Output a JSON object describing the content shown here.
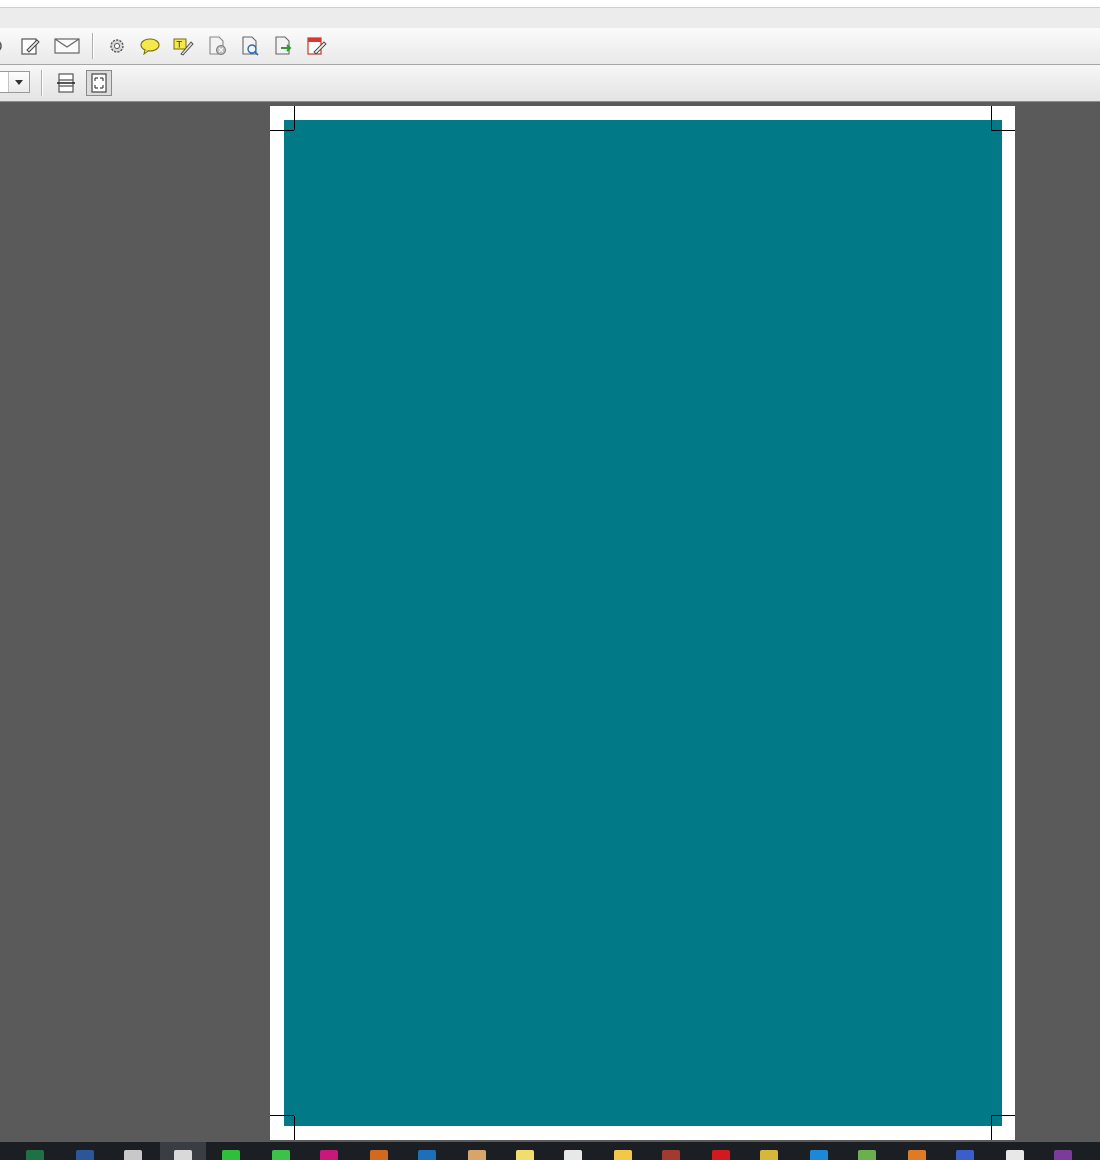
{
  "colors": {
    "viewer_bg": "#5a5a5a",
    "page": "#ffffff",
    "fill": "#017987",
    "taskbar": "#1b1e22"
  },
  "toolbar_primary": {
    "icons": [
      "edit-icon",
      "email-icon",
      "settings-gear-icon",
      "comment-icon",
      "highlight-text-icon",
      "compare-documents-icon",
      "search-document-icon",
      "export-icon",
      "sign-form-icon"
    ]
  },
  "toolbar_secondary": {
    "zoom_value": "",
    "icons": [
      "fit-width-icon",
      "fit-page-icon"
    ]
  },
  "document": {
    "fill_color": "#017987"
  },
  "taskbar": {
    "apps": [
      {
        "name": "excel-app-icon",
        "color": "#1e7145"
      },
      {
        "name": "word-app-icon",
        "color": "#2b579a"
      },
      {
        "name": "notepad-app-icon",
        "color": "#c8c8c8"
      },
      {
        "name": "acrobat-app-icon",
        "color": "#d9d9d9"
      },
      {
        "name": "dreamweaver-app-icon",
        "color": "#2fbf3a"
      },
      {
        "name": "chat-app-icon",
        "color": "#3cc24a"
      },
      {
        "name": "indesign-app-icon",
        "color": "#c9187b"
      },
      {
        "name": "illustrator-app-icon",
        "color": "#d2691e"
      },
      {
        "name": "photoshop-app-icon",
        "color": "#1c6fb8"
      },
      {
        "name": "viewer-app-icon",
        "color": "#d7a46a"
      },
      {
        "name": "sticky-notes-app-icon",
        "color": "#f2dc6b"
      },
      {
        "name": "paint-app-icon",
        "color": "#e8e8e8"
      },
      {
        "name": "file-explorer-app-icon",
        "color": "#f3c84a"
      },
      {
        "name": "package-app-icon",
        "color": "#a33a2f"
      },
      {
        "name": "red-circle-app-icon",
        "color": "#d1191f"
      },
      {
        "name": "ruler-app-icon",
        "color": "#d6b73a"
      },
      {
        "name": "info-app-icon",
        "color": "#1e88d8"
      },
      {
        "name": "green-tool-app-icon",
        "color": "#6ab04c"
      },
      {
        "name": "firefox-app-icon",
        "color": "#e07a25"
      },
      {
        "name": "blue-doc-app-icon",
        "color": "#3a5fcd"
      },
      {
        "name": "acrobat-dc-app-icon",
        "color": "#e8e8e8"
      },
      {
        "name": "onenote-app-icon",
        "color": "#7a3b9a"
      }
    ]
  }
}
